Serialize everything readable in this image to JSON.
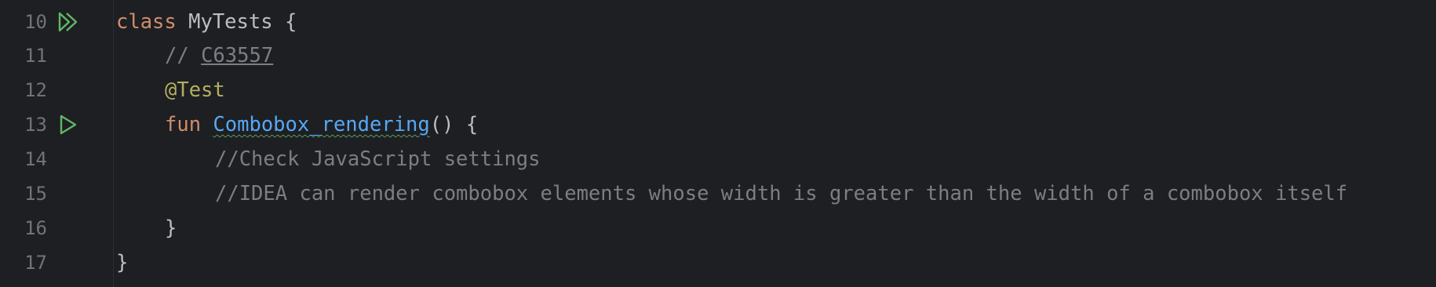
{
  "lines": [
    {
      "number": "10",
      "keyword": "class",
      "class_name": "MyTests",
      "brace": "{"
    },
    {
      "number": "11",
      "comment_prefix": "//",
      "issue_link": "C63557"
    },
    {
      "number": "12",
      "annotation": "@Test"
    },
    {
      "number": "13",
      "keyword": "fun",
      "function_name": "Combobox_rendering",
      "signature_rest": "() {"
    },
    {
      "number": "14",
      "comment": "//Check JavaScript settings"
    },
    {
      "number": "15",
      "comment": "//IDEA can render combobox elements whose width is greater than the width of a combobox itself"
    },
    {
      "number": "16",
      "brace": "}"
    },
    {
      "number": "17",
      "brace": "}"
    }
  ],
  "gutter_icons": {
    "class_run": "run-all-tests-icon",
    "method_run": "run-test-icon"
  },
  "colors": {
    "background": "#1e1f22",
    "keyword": "#cf8e6d",
    "comment": "#7a7e85",
    "annotation": "#b3ae60",
    "function": "#56a8f5",
    "run_icon": "#5fb865",
    "line_number": "#6f737a"
  }
}
